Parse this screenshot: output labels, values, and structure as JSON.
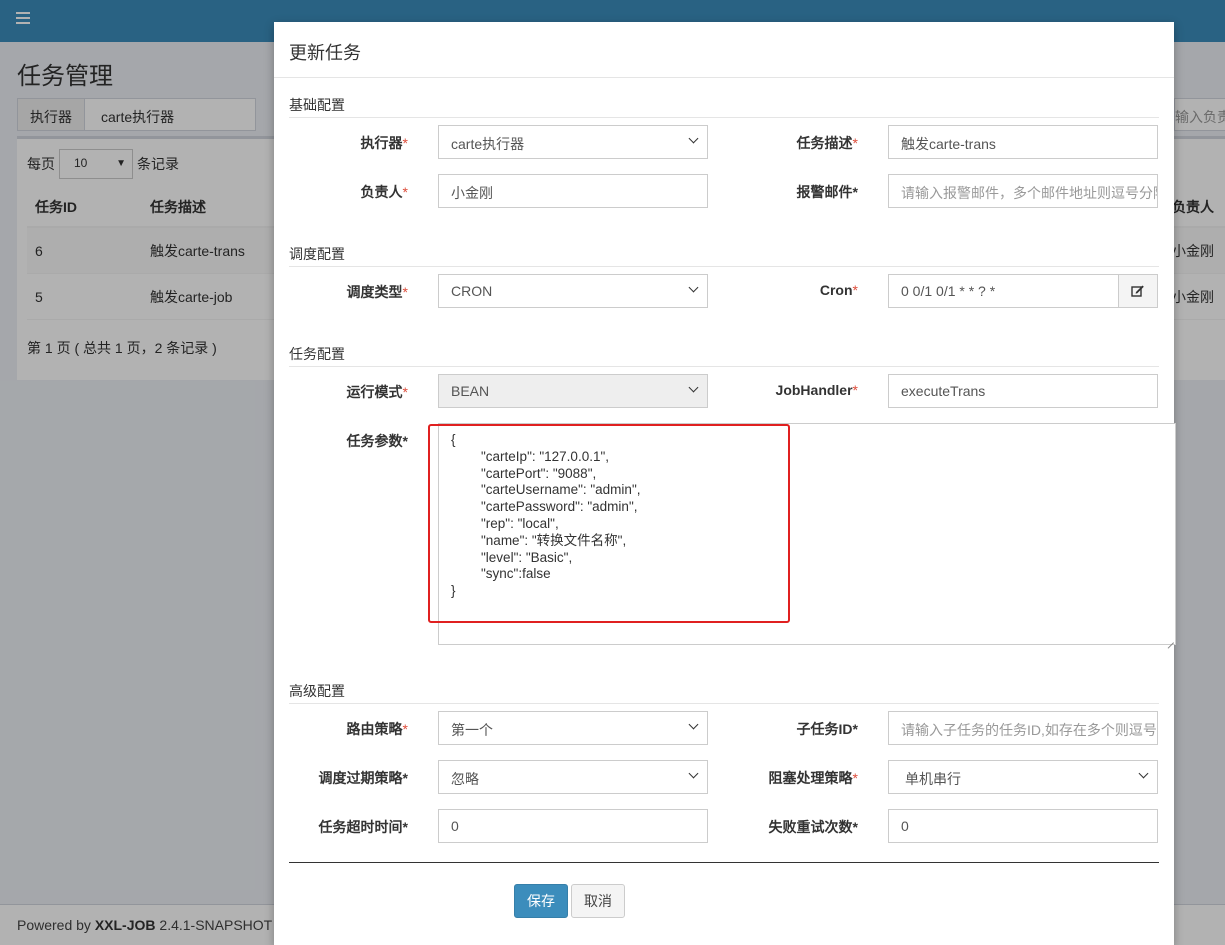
{
  "app": {
    "page_title": "任务管理",
    "filter": {
      "addon": "执行器",
      "value": "carte执行器",
      "right_placeholder": "输入负责"
    },
    "page_size": {
      "prefix": "每页",
      "value": "10",
      "suffix": "条记录"
    },
    "table": {
      "headers": [
        "任务ID",
        "任务描述"
      ],
      "owner_header": "负责人",
      "rows": [
        {
          "id": "6",
          "desc": "触发carte-trans",
          "owner": "小金刚"
        },
        {
          "id": "5",
          "desc": "触发carte-job",
          "owner": "小金刚"
        }
      ]
    },
    "page_info": "第 1 页 ( 总共 1 页，2 条记录 )",
    "footer": {
      "prefix": "Powered by ",
      "brand": "XXL-JOB",
      "version": " 2.4.1-SNAPSHOT"
    }
  },
  "modal": {
    "title": "更新任务",
    "sections": {
      "basic": "基础配置",
      "schedule": "调度配置",
      "task": "任务配置",
      "advanced": "高级配置"
    },
    "fields": {
      "executor": {
        "label": "执行器",
        "value": "carte执行器"
      },
      "job_desc": {
        "label": "任务描述",
        "value": "触发carte-trans"
      },
      "author": {
        "label": "负责人",
        "value": "小金刚"
      },
      "alarm_email": {
        "label": "报警邮件",
        "placeholder": "请输入报警邮件，多个邮件地址则逗号分隔"
      },
      "schedule_type": {
        "label": "调度类型",
        "value": "CRON"
      },
      "cron": {
        "label": "Cron",
        "value": "0 0/1 0/1 * * ? *"
      },
      "glue_type": {
        "label": "运行模式",
        "value": "BEAN"
      },
      "job_handler": {
        "label": "JobHandler",
        "value": "executeTrans"
      },
      "job_param": {
        "label": "任务参数",
        "value": "{\n        \"carteIp\": \"127.0.0.1\",\n        \"cartePort\": \"9088\",\n        \"carteUsername\": \"admin\",\n        \"cartePassword\": \"admin\",\n        \"rep\": \"local\",\n        \"name\": \"转换文件名称\",\n        \"level\": \"Basic\",\n        \"sync\":false\n}"
      },
      "route": {
        "label": "路由策略",
        "value": "第一个"
      },
      "child_job": {
        "label": "子任务ID",
        "placeholder": "请输入子任务的任务ID,如存在多个则逗号分隔"
      },
      "misfire": {
        "label": "调度过期策略",
        "value": "忽略"
      },
      "block": {
        "label": "阻塞处理策略",
        "value": "单机串行"
      },
      "timeout": {
        "label": "任务超时时间",
        "value": "0"
      },
      "retry": {
        "label": "失败重试次数",
        "value": "0"
      }
    },
    "buttons": {
      "save": "保存",
      "cancel": "取消"
    },
    "colors": {
      "primary": "#3c8dbc",
      "required": "#dd4b39",
      "highlight": "#e02020"
    }
  }
}
